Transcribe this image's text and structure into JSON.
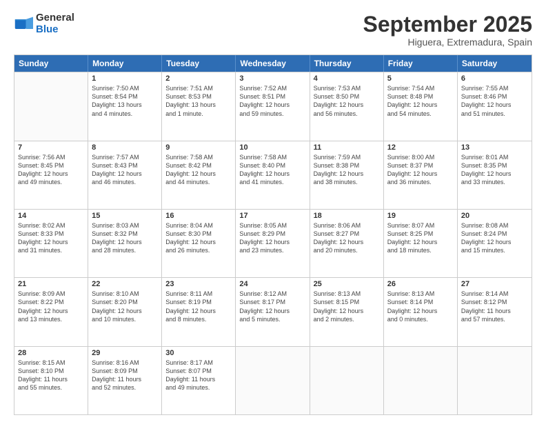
{
  "logo": {
    "general": "General",
    "blue": "Blue"
  },
  "title": "September 2025",
  "location": "Higuera, Extremadura, Spain",
  "days_header": [
    "Sunday",
    "Monday",
    "Tuesday",
    "Wednesday",
    "Thursday",
    "Friday",
    "Saturday"
  ],
  "rows": [
    [
      {
        "day": "",
        "lines": []
      },
      {
        "day": "1",
        "lines": [
          "Sunrise: 7:50 AM",
          "Sunset: 8:54 PM",
          "Daylight: 13 hours",
          "and 4 minutes."
        ]
      },
      {
        "day": "2",
        "lines": [
          "Sunrise: 7:51 AM",
          "Sunset: 8:53 PM",
          "Daylight: 13 hours",
          "and 1 minute."
        ]
      },
      {
        "day": "3",
        "lines": [
          "Sunrise: 7:52 AM",
          "Sunset: 8:51 PM",
          "Daylight: 12 hours",
          "and 59 minutes."
        ]
      },
      {
        "day": "4",
        "lines": [
          "Sunrise: 7:53 AM",
          "Sunset: 8:50 PM",
          "Daylight: 12 hours",
          "and 56 minutes."
        ]
      },
      {
        "day": "5",
        "lines": [
          "Sunrise: 7:54 AM",
          "Sunset: 8:48 PM",
          "Daylight: 12 hours",
          "and 54 minutes."
        ]
      },
      {
        "day": "6",
        "lines": [
          "Sunrise: 7:55 AM",
          "Sunset: 8:46 PM",
          "Daylight: 12 hours",
          "and 51 minutes."
        ]
      }
    ],
    [
      {
        "day": "7",
        "lines": [
          "Sunrise: 7:56 AM",
          "Sunset: 8:45 PM",
          "Daylight: 12 hours",
          "and 49 minutes."
        ]
      },
      {
        "day": "8",
        "lines": [
          "Sunrise: 7:57 AM",
          "Sunset: 8:43 PM",
          "Daylight: 12 hours",
          "and 46 minutes."
        ]
      },
      {
        "day": "9",
        "lines": [
          "Sunrise: 7:58 AM",
          "Sunset: 8:42 PM",
          "Daylight: 12 hours",
          "and 44 minutes."
        ]
      },
      {
        "day": "10",
        "lines": [
          "Sunrise: 7:58 AM",
          "Sunset: 8:40 PM",
          "Daylight: 12 hours",
          "and 41 minutes."
        ]
      },
      {
        "day": "11",
        "lines": [
          "Sunrise: 7:59 AM",
          "Sunset: 8:38 PM",
          "Daylight: 12 hours",
          "and 38 minutes."
        ]
      },
      {
        "day": "12",
        "lines": [
          "Sunrise: 8:00 AM",
          "Sunset: 8:37 PM",
          "Daylight: 12 hours",
          "and 36 minutes."
        ]
      },
      {
        "day": "13",
        "lines": [
          "Sunrise: 8:01 AM",
          "Sunset: 8:35 PM",
          "Daylight: 12 hours",
          "and 33 minutes."
        ]
      }
    ],
    [
      {
        "day": "14",
        "lines": [
          "Sunrise: 8:02 AM",
          "Sunset: 8:33 PM",
          "Daylight: 12 hours",
          "and 31 minutes."
        ]
      },
      {
        "day": "15",
        "lines": [
          "Sunrise: 8:03 AM",
          "Sunset: 8:32 PM",
          "Daylight: 12 hours",
          "and 28 minutes."
        ]
      },
      {
        "day": "16",
        "lines": [
          "Sunrise: 8:04 AM",
          "Sunset: 8:30 PM",
          "Daylight: 12 hours",
          "and 26 minutes."
        ]
      },
      {
        "day": "17",
        "lines": [
          "Sunrise: 8:05 AM",
          "Sunset: 8:29 PM",
          "Daylight: 12 hours",
          "and 23 minutes."
        ]
      },
      {
        "day": "18",
        "lines": [
          "Sunrise: 8:06 AM",
          "Sunset: 8:27 PM",
          "Daylight: 12 hours",
          "and 20 minutes."
        ]
      },
      {
        "day": "19",
        "lines": [
          "Sunrise: 8:07 AM",
          "Sunset: 8:25 PM",
          "Daylight: 12 hours",
          "and 18 minutes."
        ]
      },
      {
        "day": "20",
        "lines": [
          "Sunrise: 8:08 AM",
          "Sunset: 8:24 PM",
          "Daylight: 12 hours",
          "and 15 minutes."
        ]
      }
    ],
    [
      {
        "day": "21",
        "lines": [
          "Sunrise: 8:09 AM",
          "Sunset: 8:22 PM",
          "Daylight: 12 hours",
          "and 13 minutes."
        ]
      },
      {
        "day": "22",
        "lines": [
          "Sunrise: 8:10 AM",
          "Sunset: 8:20 PM",
          "Daylight: 12 hours",
          "and 10 minutes."
        ]
      },
      {
        "day": "23",
        "lines": [
          "Sunrise: 8:11 AM",
          "Sunset: 8:19 PM",
          "Daylight: 12 hours",
          "and 8 minutes."
        ]
      },
      {
        "day": "24",
        "lines": [
          "Sunrise: 8:12 AM",
          "Sunset: 8:17 PM",
          "Daylight: 12 hours",
          "and 5 minutes."
        ]
      },
      {
        "day": "25",
        "lines": [
          "Sunrise: 8:13 AM",
          "Sunset: 8:15 PM",
          "Daylight: 12 hours",
          "and 2 minutes."
        ]
      },
      {
        "day": "26",
        "lines": [
          "Sunrise: 8:13 AM",
          "Sunset: 8:14 PM",
          "Daylight: 12 hours",
          "and 0 minutes."
        ]
      },
      {
        "day": "27",
        "lines": [
          "Sunrise: 8:14 AM",
          "Sunset: 8:12 PM",
          "Daylight: 11 hours",
          "and 57 minutes."
        ]
      }
    ],
    [
      {
        "day": "28",
        "lines": [
          "Sunrise: 8:15 AM",
          "Sunset: 8:10 PM",
          "Daylight: 11 hours",
          "and 55 minutes."
        ]
      },
      {
        "day": "29",
        "lines": [
          "Sunrise: 8:16 AM",
          "Sunset: 8:09 PM",
          "Daylight: 11 hours",
          "and 52 minutes."
        ]
      },
      {
        "day": "30",
        "lines": [
          "Sunrise: 8:17 AM",
          "Sunset: 8:07 PM",
          "Daylight: 11 hours",
          "and 49 minutes."
        ]
      },
      {
        "day": "",
        "lines": []
      },
      {
        "day": "",
        "lines": []
      },
      {
        "day": "",
        "lines": []
      },
      {
        "day": "",
        "lines": []
      }
    ]
  ]
}
